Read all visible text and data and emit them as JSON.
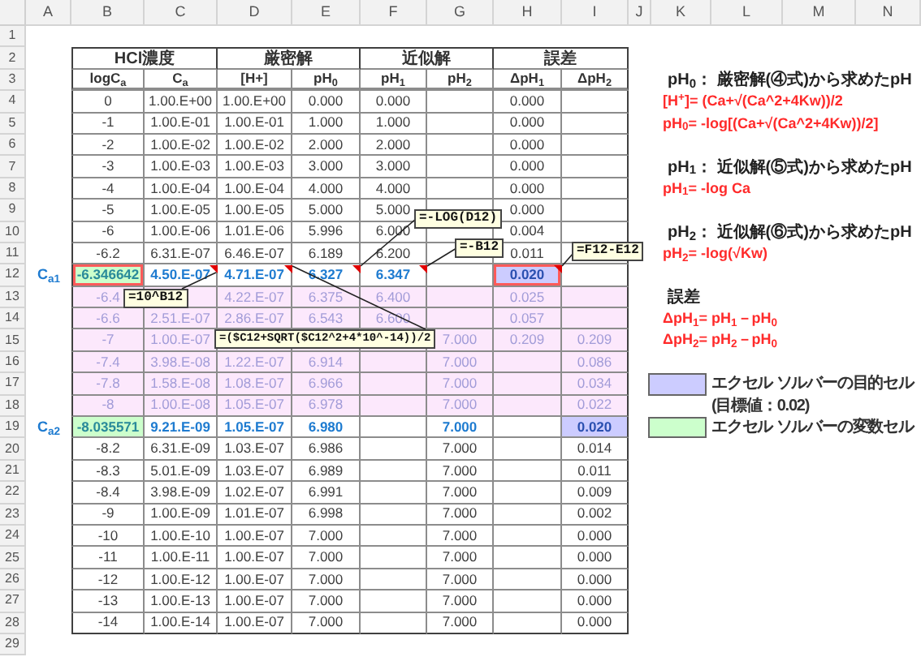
{
  "sheet": {
    "columns": [
      "A",
      "B",
      "C",
      "D",
      "E",
      "F",
      "G",
      "H",
      "I",
      "J",
      "K",
      "L",
      "M",
      "N"
    ],
    "rows": [
      "1",
      "2",
      "3",
      "4",
      "5",
      "6",
      "7",
      "8",
      "9",
      "10",
      "11",
      "12",
      "13",
      "14",
      "15",
      "16",
      "17",
      "18",
      "19",
      "20",
      "21",
      "22",
      "23",
      "24",
      "25",
      "26",
      "27",
      "28",
      "29"
    ]
  },
  "table": {
    "groups": [
      "HCl濃度",
      "厳密解",
      "近似解",
      "誤差"
    ],
    "columns": [
      "logC$_{a}$",
      "C$_{a}$",
      "[H+]",
      "pH$_{0}$",
      "pH$_{1}$",
      "pH$_{2}$",
      "ΔpH$_{1}$",
      "ΔpH$_{2}$"
    ],
    "rows": [
      {
        "kind": "plain",
        "cells": [
          "0",
          "1.00.E+00",
          "1.00.E+00",
          "0.000",
          "0.000",
          null,
          "0.000",
          null
        ]
      },
      {
        "kind": "plain",
        "cells": [
          "-1",
          "1.00.E-01",
          "1.00.E-01",
          "1.000",
          "1.000",
          null,
          "0.000",
          null
        ]
      },
      {
        "kind": "plain",
        "cells": [
          "-2",
          "1.00.E-02",
          "1.00.E-02",
          "2.000",
          "2.000",
          null,
          "0.000",
          null
        ]
      },
      {
        "kind": "plain",
        "cells": [
          "-3",
          "1.00.E-03",
          "1.00.E-03",
          "3.000",
          "3.000",
          null,
          "0.000",
          null
        ]
      },
      {
        "kind": "plain",
        "cells": [
          "-4",
          "1.00.E-04",
          "1.00.E-04",
          "4.000",
          "4.000",
          null,
          "0.000",
          null
        ]
      },
      {
        "kind": "plain",
        "cells": [
          "-5",
          "1.00.E-05",
          "1.00.E-05",
          "5.000",
          "5.000",
          null,
          "0.000",
          null
        ]
      },
      {
        "kind": "plain",
        "cells": [
          "-6",
          "1.00.E-06",
          "1.01.E-06",
          "5.996",
          "6.000",
          null,
          "0.004",
          null
        ]
      },
      {
        "kind": "plain",
        "cells": [
          "-6.2",
          "6.31.E-07",
          "6.46.E-07",
          "6.189",
          "6.200",
          null,
          "0.011",
          null
        ]
      },
      {
        "kind": "solution",
        "side_label": "C$_{a1}$",
        "cells": [
          {
            "text": "-6.346642",
            "variable": true,
            "boxed": true
          },
          "4.50.E-07",
          "4.71.E-07",
          "6.327",
          "6.347",
          null,
          {
            "text": "0.020",
            "target": true,
            "boxed": true
          },
          null
        ]
      },
      {
        "kind": "shaded",
        "cells": [
          "-6.4",
          null,
          "4.22.E-07",
          "6.375",
          "6.400",
          null,
          "0.025",
          null
        ]
      },
      {
        "kind": "shaded",
        "cells": [
          "-6.6",
          "2.51.E-07",
          "2.86.E-07",
          "6.543",
          "6.600",
          null,
          "0.057",
          null
        ]
      },
      {
        "kind": "shaded",
        "cells": [
          "-7",
          "1.00.E-07",
          null,
          null,
          null,
          "7.000",
          "0.209",
          "0.209"
        ]
      },
      {
        "kind": "shaded",
        "cells": [
          "-7.4",
          "3.98.E-08",
          "1.22.E-07",
          "6.914",
          null,
          "7.000",
          null,
          "0.086"
        ]
      },
      {
        "kind": "shaded",
        "cells": [
          "-7.8",
          "1.58.E-08",
          "1.08.E-07",
          "6.966",
          null,
          "7.000",
          null,
          "0.034"
        ]
      },
      {
        "kind": "shaded",
        "cells": [
          "-8",
          "1.00.E-08",
          "1.05.E-07",
          "6.978",
          null,
          "7.000",
          null,
          "0.022"
        ]
      },
      {
        "kind": "solution",
        "side_label": "C$_{a2}$",
        "cells": [
          {
            "text": "-8.035571",
            "variable": true,
            "boxed": false
          },
          "9.21.E-09",
          "1.05.E-07",
          "6.980",
          null,
          "7.000",
          null,
          {
            "text": "0.020",
            "target": true,
            "boxed": false
          }
        ]
      },
      {
        "kind": "plain",
        "cells": [
          "-8.2",
          "6.31.E-09",
          "1.03.E-07",
          "6.986",
          null,
          "7.000",
          null,
          "0.014"
        ]
      },
      {
        "kind": "plain",
        "cells": [
          "-8.3",
          "5.01.E-09",
          "1.03.E-07",
          "6.989",
          null,
          "7.000",
          null,
          "0.011"
        ]
      },
      {
        "kind": "plain",
        "cells": [
          "-8.4",
          "3.98.E-09",
          "1.02.E-07",
          "6.991",
          null,
          "7.000",
          null,
          "0.009"
        ]
      },
      {
        "kind": "plain",
        "cells": [
          "-9",
          "1.00.E-09",
          "1.01.E-07",
          "6.998",
          null,
          "7.000",
          null,
          "0.002"
        ]
      },
      {
        "kind": "plain",
        "cells": [
          "-10",
          "1.00.E-10",
          "1.00.E-07",
          "7.000",
          null,
          "7.000",
          null,
          "0.000"
        ]
      },
      {
        "kind": "plain",
        "cells": [
          "-11",
          "1.00.E-11",
          "1.00.E-07",
          "7.000",
          null,
          "7.000",
          null,
          "0.000"
        ]
      },
      {
        "kind": "plain",
        "cells": [
          "-12",
          "1.00.E-12",
          "1.00.E-07",
          "7.000",
          null,
          "7.000",
          null,
          "0.000"
        ]
      },
      {
        "kind": "plain",
        "cells": [
          "-13",
          "1.00.E-13",
          "1.00.E-07",
          "7.000",
          null,
          "7.000",
          null,
          "0.000"
        ]
      },
      {
        "kind": "plain",
        "cells": [
          "-14",
          "1.00.E-14",
          "1.00.E-07",
          "7.000",
          null,
          "7.000",
          null,
          "0.000"
        ]
      }
    ]
  },
  "callouts": [
    "=10^B12",
    "=-LOG(D12)",
    "=-B12",
    "=F12-E12",
    "=($C12+SQRT($C12^2+4*10^-14))/2"
  ],
  "notes": [
    {
      "kind": "heading",
      "text": "pH$_{0}$： 厳密解(④式)から求めたpH"
    },
    {
      "kind": "formula",
      "text": "[H$^{+}$]= (Ca+√(Ca^2+4Kw))/2"
    },
    {
      "kind": "formula",
      "text": "pH$_{0}$= -log[(Ca+√(Ca^2+4Kw))/2]"
    },
    {
      "kind": "heading",
      "text": "pH$_{1}$： 近似解(⑤式)から求めたpH"
    },
    {
      "kind": "formula",
      "text": "pH$_{1}$= -log Ca"
    },
    {
      "kind": "heading",
      "text": "pH$_{2}$： 近似解(⑥式)から求めたpH"
    },
    {
      "kind": "formula",
      "text": "pH$_{2}$= -log(√Kw)"
    },
    {
      "kind": "heading",
      "text": "誤差"
    },
    {
      "kind": "formula",
      "text": "ΔpH$_{1}$= pH$_{1}$－pH$_{0}$"
    },
    {
      "kind": "formula",
      "text": "ΔpH$_{2}$= pH$_{2}$－pH$_{0}$"
    },
    {
      "kind": "legend",
      "color": "#ccccff",
      "text": "エクセル ソルバーの目的セル"
    },
    {
      "kind": "subnote",
      "text": "(目標値：0.02)"
    },
    {
      "kind": "legend",
      "color": "#ccffcc",
      "text": "エクセル ソルバーの変数セル"
    }
  ]
}
